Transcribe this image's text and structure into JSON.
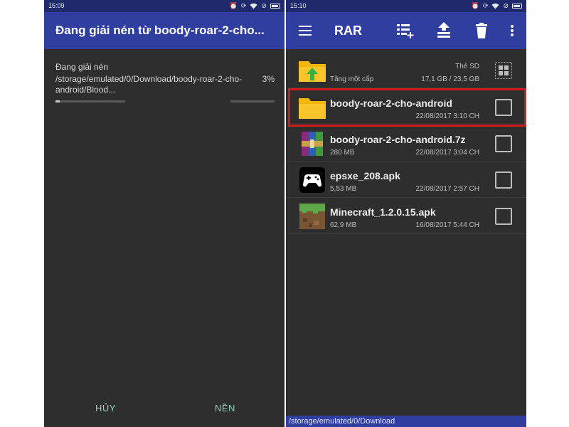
{
  "left_screen": {
    "status": {
      "time": "15:09"
    },
    "title": "Đang giải nén từ boody-roar-2-cho...",
    "extract_label": "Đang giải nén",
    "extract_path": "/storage/emulated/0/Download/boody-roar-2-cho-android/Blood...",
    "percent_text": "3%",
    "progress": 0.03,
    "buttons": {
      "cancel": "HỦY",
      "background": "NỀN"
    }
  },
  "right_screen": {
    "status": {
      "time": "15:10"
    },
    "appbar": {
      "title": "RAR",
      "icons": [
        "menu-icon",
        "archive-add-icon",
        "extract-icon",
        "trash-icon",
        "more-vert-icon"
      ]
    },
    "storage": {
      "name": "Thẻ SD",
      "usage": "17,1 GB / 23,5 GB"
    },
    "up_label": "Tầng một cấp",
    "files": [
      {
        "name": "boody-roar-2-cho-android",
        "size": "",
        "date": "22/08/2017 3:10 CH",
        "icon": "folder-icon",
        "highlighted": true
      },
      {
        "name": "boody-roar-2-cho-android.7z",
        "size": "280 MB",
        "date": "22/08/2017 3:04 CH",
        "icon": "rar-archive-icon",
        "highlighted": false
      },
      {
        "name": "epsxe_208.apk",
        "size": "5,53 MB",
        "date": "22/08/2017 2:57 CH",
        "icon": "gamepad-app-icon",
        "highlighted": false
      },
      {
        "name": "Minecraft_1.2.0.15.apk",
        "size": "62,9 MB",
        "date": "16/08/2017 5:44 CH",
        "icon": "minecraft-app-icon",
        "highlighted": false
      }
    ],
    "current_path": "/storage/emulated/0/Download"
  },
  "colors": {
    "appbar": "#303f9f",
    "statusbar": "#1e2a6b",
    "background": "#2e2e2e",
    "folder": "#f5b60c",
    "highlight": "#d41a1a",
    "dialog_button": "#8fd0b6"
  }
}
